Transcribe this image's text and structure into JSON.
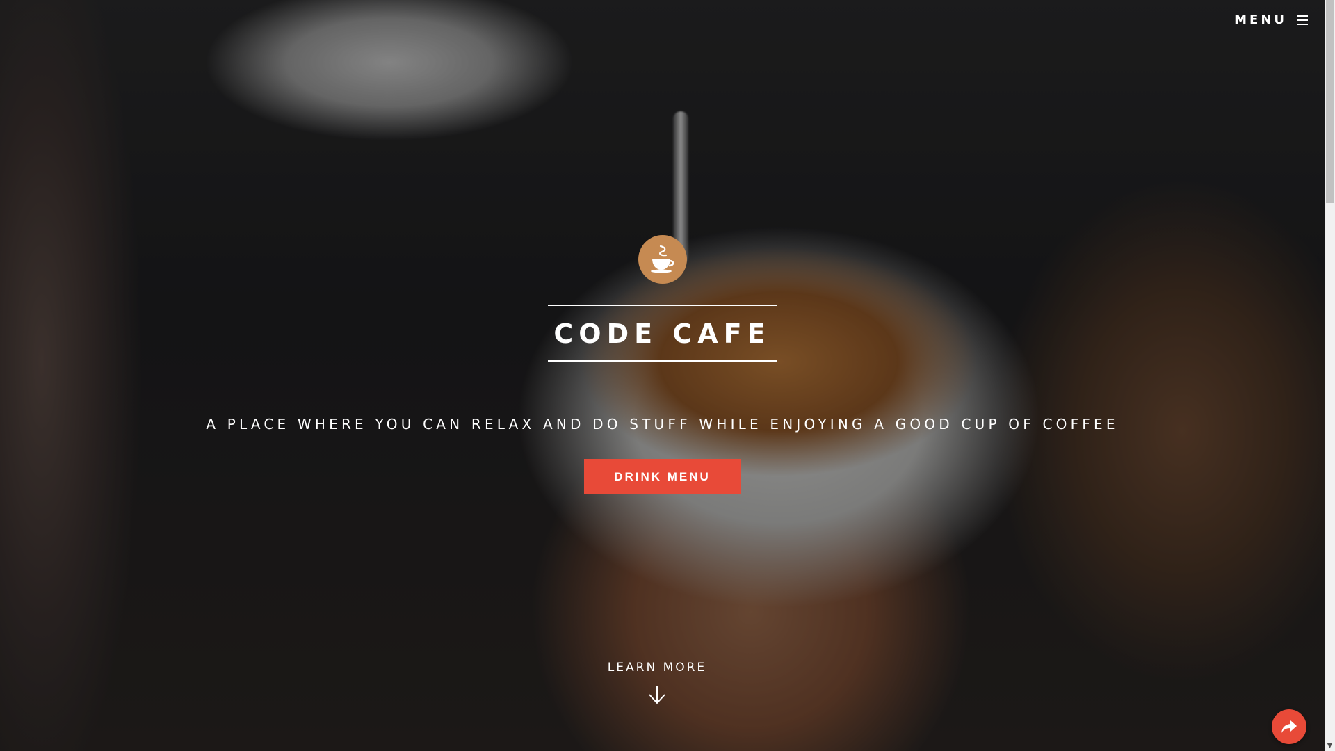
{
  "nav": {
    "menu_label": "MENU",
    "menu_icon": "hamburger-icon"
  },
  "hero": {
    "logo_icon": "coffee-cup-icon",
    "title": "CODE CAFE",
    "tagline": "A PLACE WHERE YOU CAN RELAX AND DO STUFF WHILE ENJOYING A GOOD CUP OF COFFEE",
    "cta_label": "DRINK MENU",
    "learn_more_label": "LEARN MORE",
    "learn_more_icon": "arrow-down-icon"
  },
  "share_button": {
    "icon": "share-icon"
  },
  "colors": {
    "accent": "#e84a38",
    "logo": "#c68a52",
    "text": "#ffffff"
  }
}
